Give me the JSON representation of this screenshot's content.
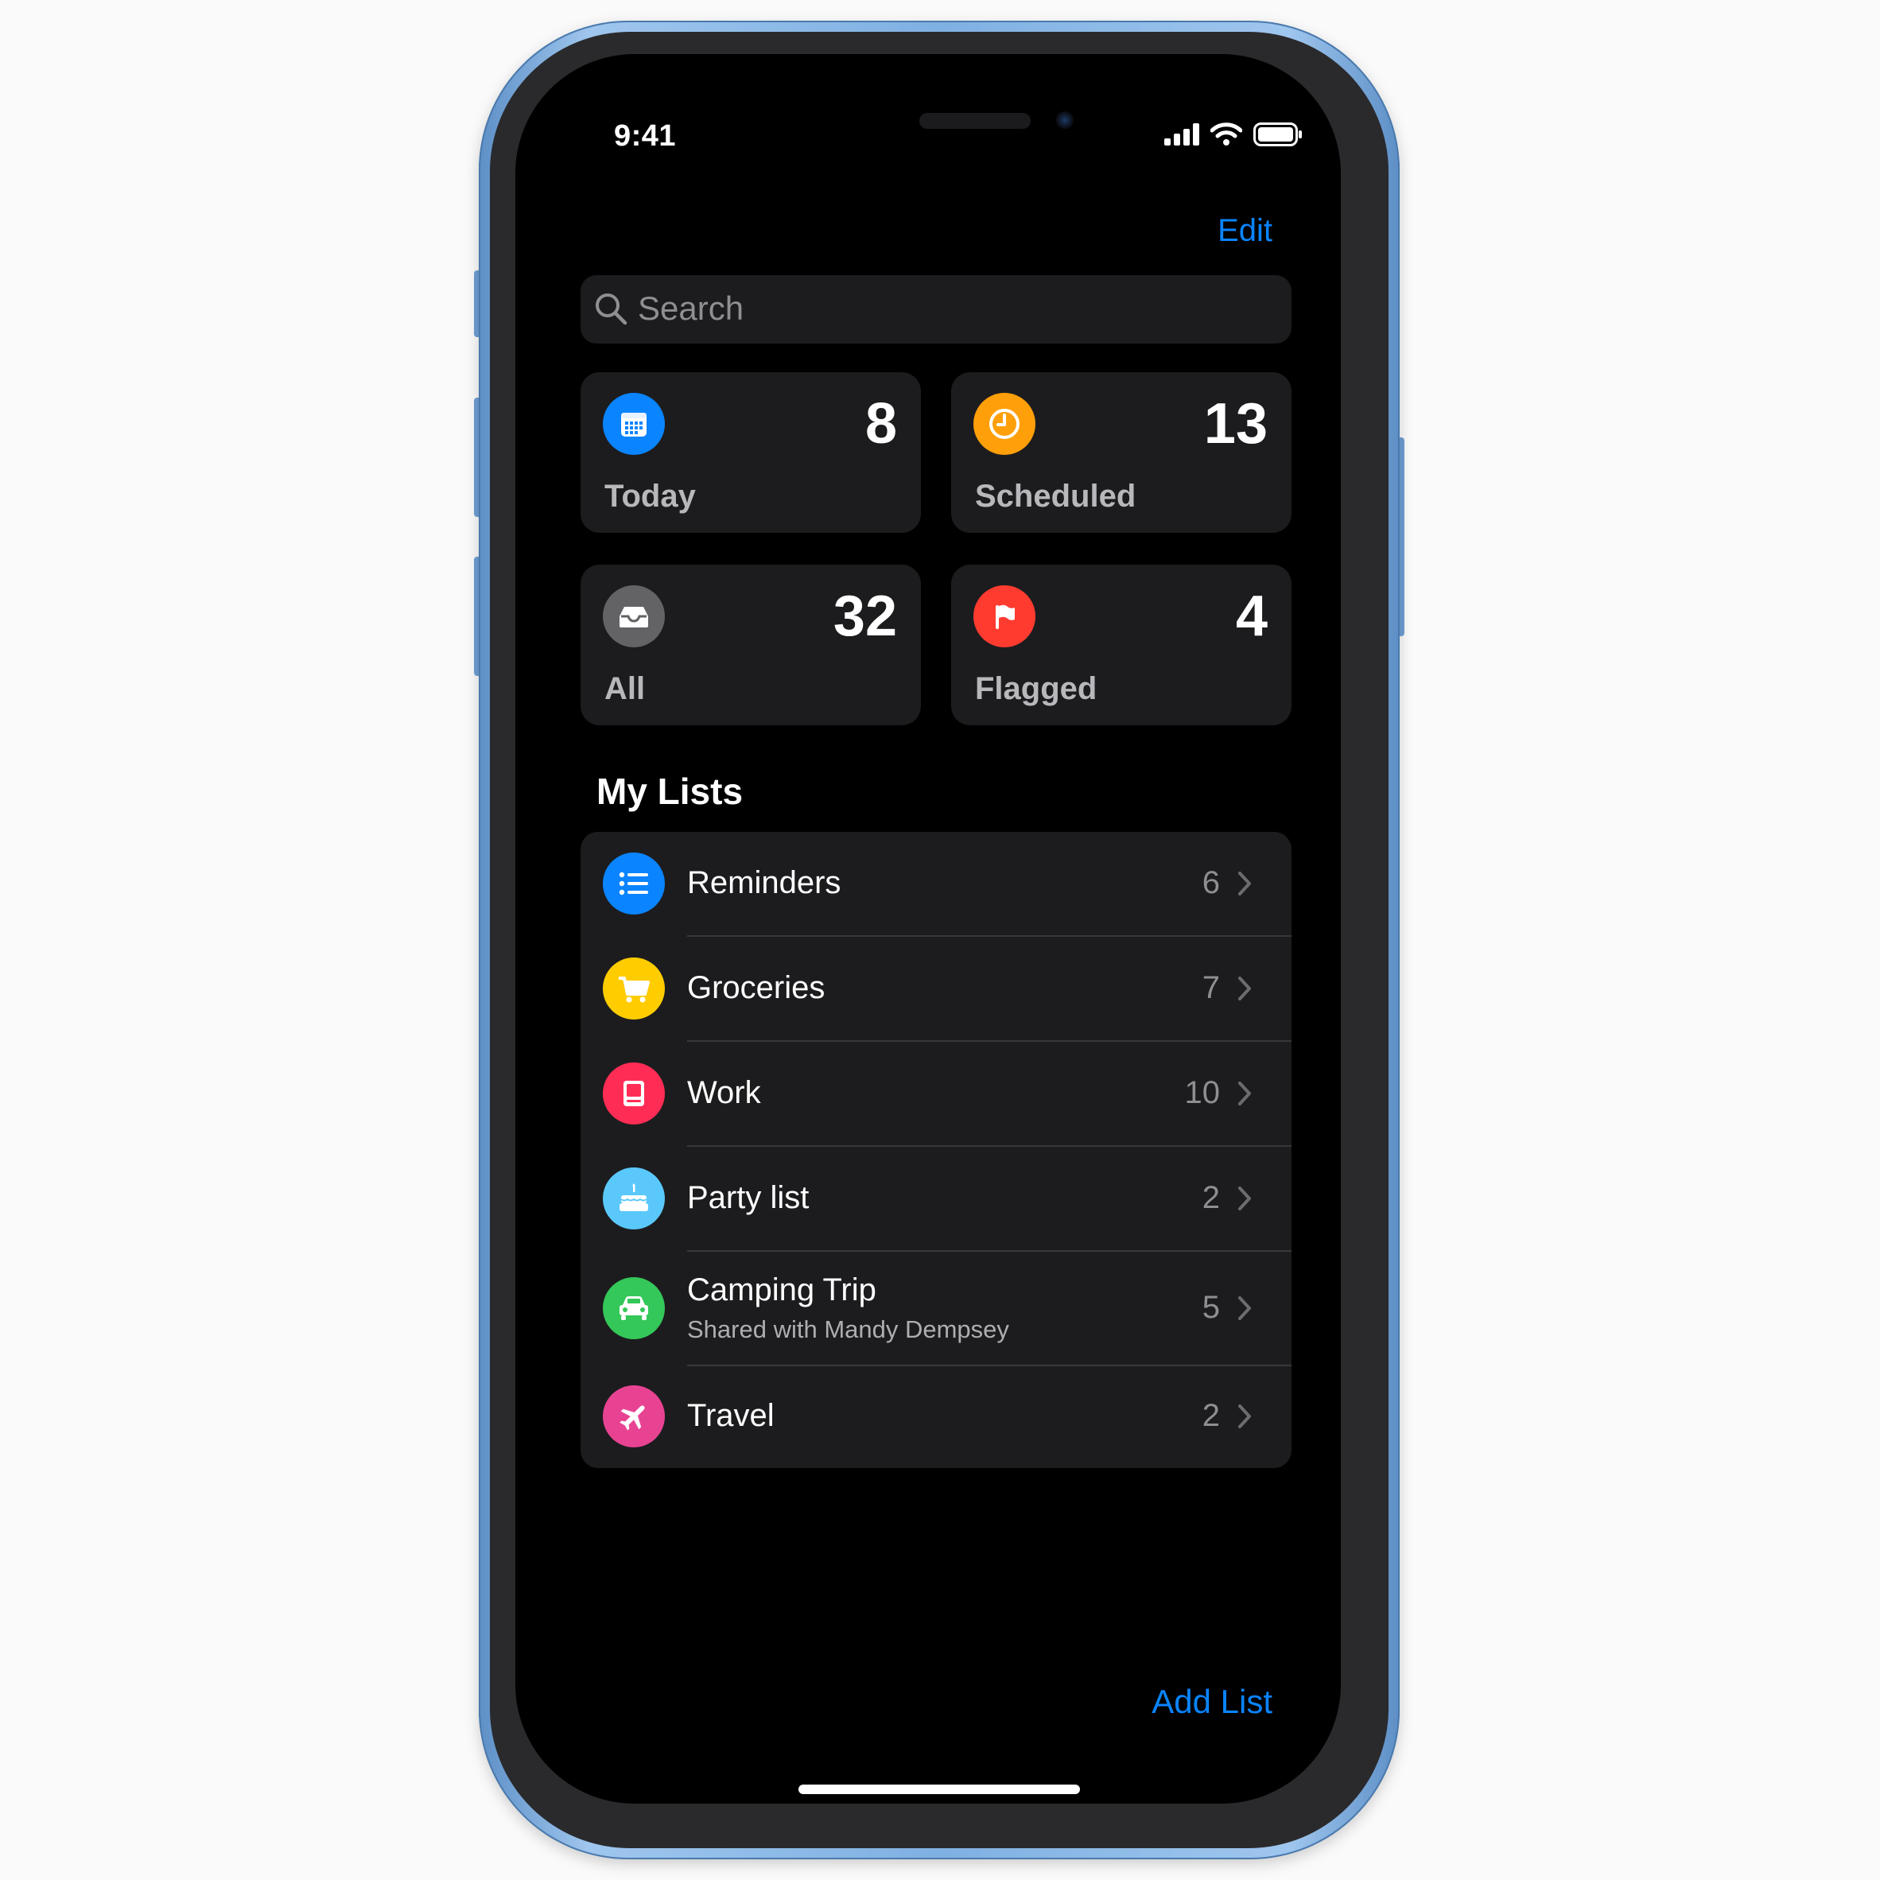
{
  "status": {
    "time": "9:41"
  },
  "header": {
    "edit_label": "Edit"
  },
  "search": {
    "placeholder": "Search"
  },
  "smart_lists": [
    {
      "label": "Today",
      "count": "8",
      "icon": "calendar-icon",
      "color": "#0a84ff"
    },
    {
      "label": "Scheduled",
      "count": "13",
      "icon": "clock-icon",
      "color": "#ff9f0a"
    },
    {
      "label": "All",
      "count": "32",
      "icon": "tray-icon",
      "color": "#636366"
    },
    {
      "label": "Flagged",
      "count": "4",
      "icon": "flag-icon",
      "color": "#ff3b30"
    }
  ],
  "my_lists": {
    "title": "My Lists",
    "items": [
      {
        "name": "Reminders",
        "count": "6",
        "icon": "list-bullet-icon",
        "color": "#0a84ff"
      },
      {
        "name": "Groceries",
        "count": "7",
        "icon": "cart-icon",
        "color": "#ffcc00"
      },
      {
        "name": "Work",
        "count": "10",
        "icon": "computer-icon",
        "color": "#ff2d55"
      },
      {
        "name": "Party list",
        "count": "2",
        "icon": "cake-icon",
        "color": "#5ac8fa"
      },
      {
        "name": "Camping Trip",
        "subtitle": "Shared with Mandy Dempsey",
        "count": "5",
        "icon": "car-icon",
        "color": "#34c759"
      },
      {
        "name": "Travel",
        "count": "2",
        "icon": "airplane-icon",
        "color": "#e84393"
      }
    ]
  },
  "footer": {
    "add_list_label": "Add List"
  }
}
